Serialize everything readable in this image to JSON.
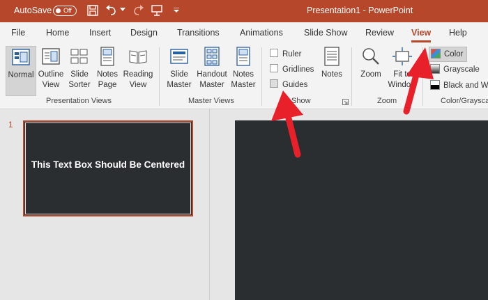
{
  "titlebar": {
    "autosave_label": "AutoSave",
    "autosave_state": "Off",
    "title": "Presentation1 - PowerPoint",
    "colors": {
      "background": "#b7472a",
      "text": "#ffffff"
    },
    "quick_access_icons": [
      "save-icon",
      "undo-icon",
      "redo-icon",
      "present-icon",
      "customize-icon"
    ]
  },
  "tabs": {
    "items": [
      "File",
      "Home",
      "Insert",
      "Design",
      "Transitions",
      "Animations",
      "Slide Show",
      "Review",
      "View",
      "Help"
    ],
    "active": "View"
  },
  "ribbon": {
    "presentation_views": {
      "label": "Presentation Views",
      "normal": "Normal",
      "outline_1": "Outline",
      "outline_2": "View",
      "sorter_1": "Slide",
      "sorter_2": "Sorter",
      "notes_page_1": "Notes",
      "notes_page_2": "Page",
      "reading_1": "Reading",
      "reading_2": "View",
      "selected": "Normal"
    },
    "master_views": {
      "label": "Master Views",
      "slide_master_1": "Slide",
      "slide_master_2": "Master",
      "handout_master_1": "Handout",
      "handout_master_2": "Master",
      "notes_master_1": "Notes",
      "notes_master_2": "Master"
    },
    "show": {
      "label": "Show",
      "ruler": "Ruler",
      "gridlines": "Gridlines",
      "guides": "Guides",
      "notes": "Notes"
    },
    "zoom": {
      "label": "Zoom",
      "zoom": "Zoom",
      "fit_1": "Fit to",
      "fit_2": "Window"
    },
    "color_grayscale": {
      "label": "Color/Grayscale",
      "color": "Color",
      "grayscale": "Grayscale",
      "bw": "Black and White",
      "selected": "Color"
    }
  },
  "slides": {
    "number": "1",
    "thumb_text": "This Text Box Should Be Centered"
  },
  "annotations": {
    "arrow_color": "#e8202a"
  },
  "colors": {
    "accent": "#b7472a",
    "slide_bg": "#2b2e31",
    "ribbon_bg": "#f3f3f3"
  }
}
